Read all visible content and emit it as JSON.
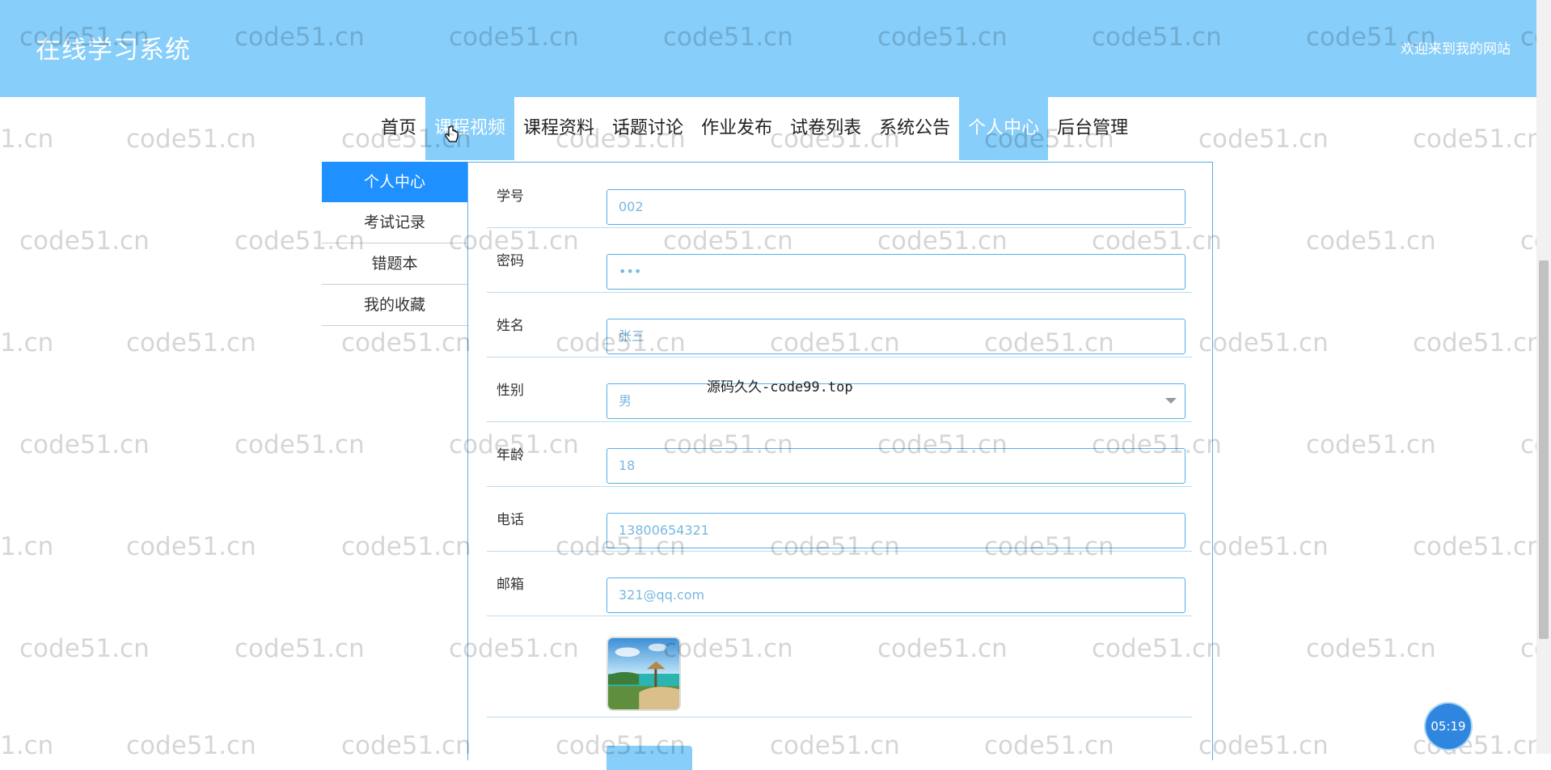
{
  "header": {
    "brand": "在线学习系统",
    "welcome": "欢迎来到我的网站"
  },
  "nav": {
    "items": [
      "首页",
      "课程视频",
      "课程资料",
      "话题讨论",
      "作业发布",
      "试卷列表",
      "系统公告",
      "个人中心",
      "后台管理"
    ],
    "active": [
      "课程视频",
      "个人中心"
    ]
  },
  "side_menu": {
    "items": [
      "个人中心",
      "考试记录",
      "错题本",
      "我的收藏"
    ],
    "selected": "个人中心"
  },
  "form": {
    "fields": [
      {
        "label": "学号",
        "value": "002"
      },
      {
        "label": "密码",
        "value": "•••"
      },
      {
        "label": "姓名",
        "value": "张三"
      },
      {
        "label": "性别",
        "value": "男"
      },
      {
        "label": "年龄",
        "value": "18"
      },
      {
        "label": "电话",
        "value": "13800654321"
      },
      {
        "label": "邮箱",
        "value": "321@qq.com"
      }
    ]
  },
  "watermarks": {
    "code51": "code51.cn",
    "code51_partial_left": "1.cn",
    "code51_partial_right": "co",
    "code99": "源码久久-code99.top"
  },
  "timer": "05:19",
  "colors": {
    "header_bg": "#87cefa",
    "active_nav_bg": "#87cefa",
    "side_active_bg": "#1e90ff",
    "input_border": "#5aaee8",
    "input_text": "#7ab8e0"
  },
  "icons": [
    "hand-cursor-icon",
    "chevron-down-icon"
  ]
}
